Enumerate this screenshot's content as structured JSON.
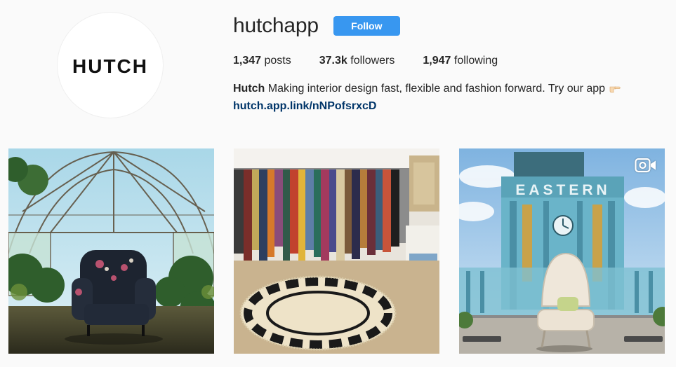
{
  "profile": {
    "avatar_text": "HUTCH",
    "username": "hutchapp",
    "follow_label": "Follow",
    "stats": {
      "posts_count": "1,347",
      "posts_label": "posts",
      "followers_count": "37.3k",
      "followers_label": "followers",
      "following_count": "1,947",
      "following_label": "following"
    },
    "bio": {
      "name": "Hutch",
      "text": "Making interior design fast, flexible and fashion forward. Try our app",
      "link": "hutch.app.link/nNPofsrxcD"
    }
  },
  "posts": [
    {
      "sign_text": ""
    },
    {
      "sign_text": ""
    },
    {
      "sign_text": "EASTERN",
      "type_icon": "video-camera-icon"
    }
  ],
  "colors": {
    "follow_button": "#3897f0",
    "link": "#003569",
    "background": "#fafafa"
  }
}
